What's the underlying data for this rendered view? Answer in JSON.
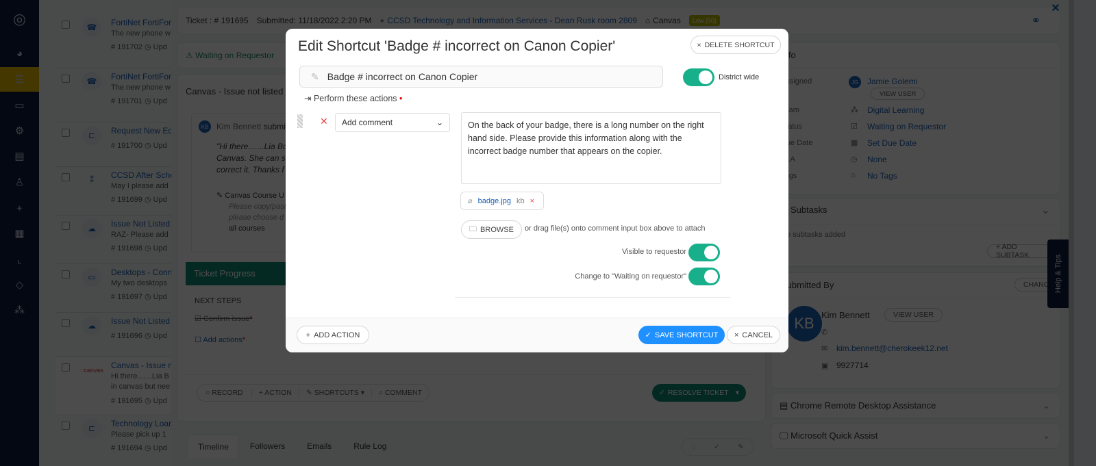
{
  "sidebar": {
    "icons": [
      "logo-icon",
      "dashboard-icon",
      "tickets-icon",
      "devices-icon",
      "settings-icon",
      "knowledge-icon",
      "user-icon",
      "location-icon",
      "calendar-icon",
      "reports-icon",
      "integrations-icon",
      "org-chart-icon"
    ],
    "accent": "#e6b800"
  },
  "ticket_list": [
    {
      "title": "FortiNet FortiFone",
      "desc": "The new phone w",
      "id": "# 191702",
      "upd": "Upd"
    },
    {
      "title": "FortiNet FortiFone",
      "desc": "The new phone w",
      "id": "# 191701",
      "upd": "Upd"
    },
    {
      "title": "Request New Equipment",
      "desc": "",
      "id": "# 191700",
      "upd": "Upd"
    },
    {
      "title": "CCSD After School",
      "desc": "May I please add",
      "id": "# 191699",
      "upd": "Upd"
    },
    {
      "title": "Issue Not Listed",
      "desc": "RAZ- Please add",
      "id": "# 191698",
      "upd": "Upd"
    },
    {
      "title": "Desktops - Connect",
      "desc": "My two desktops",
      "id": "# 191697",
      "upd": "Upd"
    },
    {
      "title": "Issue Not Listed",
      "desc": "",
      "id": "# 191696",
      "upd": "Upd"
    },
    {
      "title": "Canvas - Issue not listed",
      "desc": "Hi there.......Lia B",
      "desc2": "in canvas but nee",
      "id": "# 191695",
      "upd": "Upd",
      "thumb": "canvas"
    },
    {
      "title": "Technology Loaner",
      "desc": "Please pick up 1",
      "id": "# 191694",
      "upd": "Upd"
    }
  ],
  "ticket": {
    "number": "Ticket : # 191695",
    "submitted": "Submitted: 11/18/2022 2:20 PM",
    "location": "CCSD Technology and Information Services  - Dean Rusk room 2809",
    "category": "Canvas",
    "priority": "Low (50)",
    "status": "Waiting on Requestor",
    "subject": "Canvas - Issue not listed",
    "submitter_initials": "KB",
    "submitter_text": "Kim Bennett",
    "submitted_word": "submitted",
    "quote_lines": [
      "\"Hi there.......Lia Bo",
      "Canvas. She can se",
      "correct it. Thanks f"
    ],
    "field_label": "Canvas Course U",
    "field_lines": [
      "Please copy/past",
      "please choose d",
      "all courses"
    ],
    "progress_title": "Ticket Progress",
    "next_steps": "NEXT STEPS",
    "steps": [
      {
        "label": "Confirm issue",
        "done": true
      },
      {
        "label": "Add actions",
        "done": false
      }
    ],
    "actions": [
      "RECORD",
      "+ ACTION",
      "SHORTCUTS",
      "COMMENT"
    ],
    "resolve": "RESOLVE TICKET",
    "tabs": [
      "Timeline",
      "Followers",
      "Emails",
      "Rule Log"
    ]
  },
  "info": {
    "header": "Info",
    "rows": [
      {
        "label": "Assigned",
        "value": "Jamie Golemi",
        "initials": "JG",
        "button": "VIEW USER"
      },
      {
        "label": "Team",
        "value": "Digital Learning"
      },
      {
        "label": "Status",
        "value": "Waiting on Requestor"
      },
      {
        "label": "Due Date",
        "value": "Set Due Date"
      },
      {
        "label": "SLA",
        "value": "None"
      },
      {
        "label": "Tags",
        "value": "No Tags"
      }
    ],
    "subtasks": "Subtasks",
    "no_subtasks": "No subtasks added",
    "add_subtask": "+ ADD SUBTASK",
    "submitted_by": "Submitted By",
    "change": "CHANGE",
    "submitter": {
      "initials": "KB",
      "name": "Kim Bennett",
      "view": "VIEW USER",
      "email": "kim.bennett@cherokeek12.net",
      "id": "9927714"
    },
    "chrome": "Chrome Remote Desktop Assistance",
    "quick_assist": "Microsoft Quick Assist",
    "help": "Help & Tips"
  },
  "modal": {
    "title": "Edit Shortcut 'Badge # incorrect on Canon Copier'",
    "delete": "DELETE SHORTCUT",
    "name_value": "Badge # incorrect on Canon Copier",
    "district_wide": "District wide",
    "district_wide_on": true,
    "perform": "Perform these actions",
    "action_select": "Add comment",
    "comment": "On the back of your badge, there is a long number on the right hand side. Please provide this information along with the incorrect badge number that appears on the copier.",
    "attachment": {
      "name": "badge.jpg",
      "size": "kb"
    },
    "browse": "BROWSE",
    "drag_hint": "or drag file(s) onto comment input box above to attach",
    "visible": "Visible to requestor",
    "visible_on": true,
    "change_status": "Change to \"Waiting on requestor\"",
    "change_status_on": true,
    "add_action": "ADD ACTION",
    "save": "SAVE SHORTCUT",
    "cancel": "CANCEL",
    "colors": {
      "toggle": "#17b08b",
      "save": "#1e90ff"
    }
  }
}
